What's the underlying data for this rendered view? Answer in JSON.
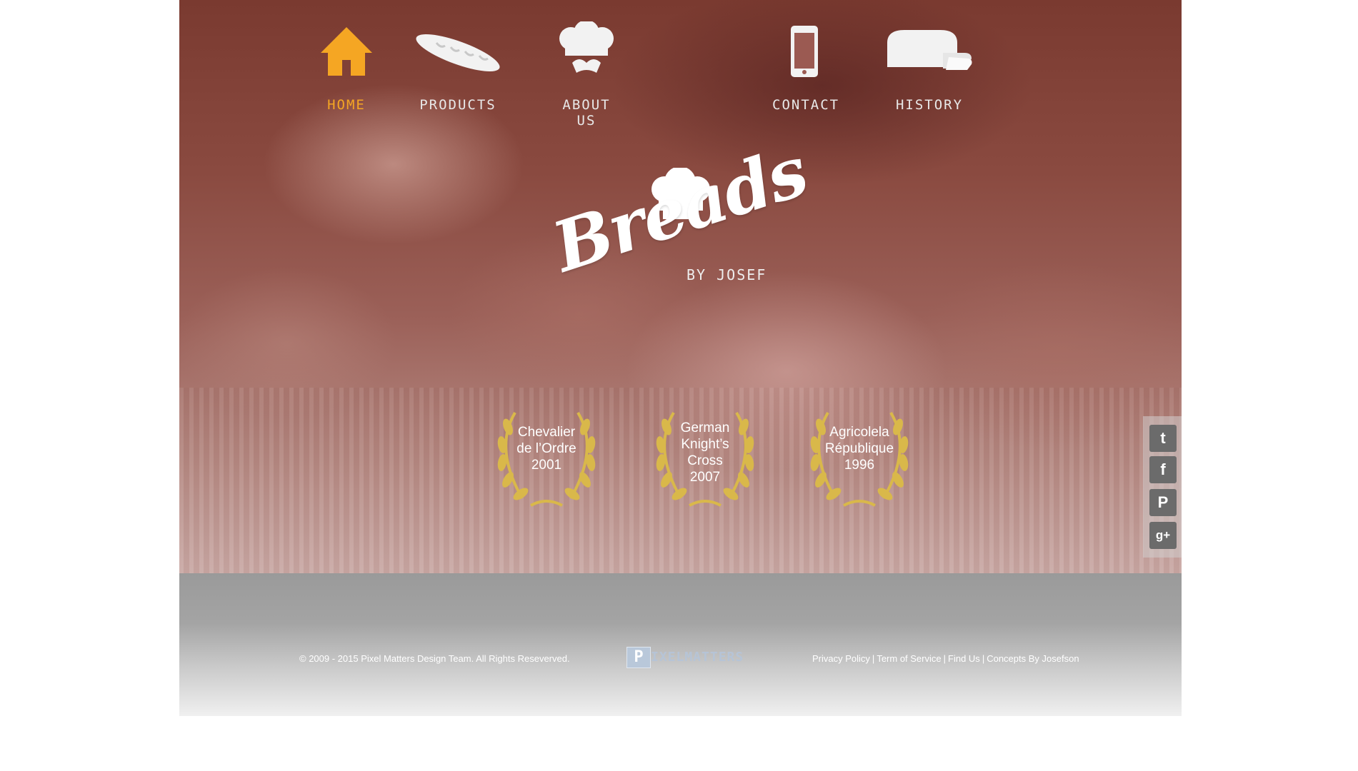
{
  "nav": {
    "items": [
      {
        "label": "HOME",
        "icon": "home-icon",
        "active": true
      },
      {
        "label": "PRODUCTS",
        "icon": "baguette-icon",
        "active": false
      },
      {
        "label": "ABOUT US",
        "icon": "chef-hat-icon",
        "active": false
      },
      {
        "label": "CONTACT",
        "icon": "smartphone-icon",
        "active": false
      },
      {
        "label": "HISTORY",
        "icon": "bread-loaf-icon",
        "active": false
      }
    ]
  },
  "logo": {
    "word": "Breads",
    "sub": "BY JOSEF",
    "icon": "chef-hat-icon"
  },
  "awards": [
    {
      "text": "Chevalier\nde l’Ordre\n2001",
      "icon": "laurel-wreath-icon"
    },
    {
      "text": "German\nKnight’s\nCross\n2007",
      "icon": "laurel-wreath-icon"
    },
    {
      "text": "Agricolela\nRépublique\n1996",
      "icon": "laurel-wreath-icon"
    }
  ],
  "social": [
    {
      "label": "t",
      "icon": "twitter-icon"
    },
    {
      "label": "f",
      "icon": "facebook-icon"
    },
    {
      "label": "P",
      "icon": "pinterest-icon"
    },
    {
      "label": "g+",
      "icon": "google-plus-icon"
    }
  ],
  "footer": {
    "copyright": "© 2009 - 2015 Pixel Matters Design Team. All Rights Reseverved.",
    "brand_initial": "P",
    "brand_rest": "IXELMATTERS",
    "links": [
      "Privacy Policy",
      "Term of Service",
      "Find Us",
      "Concepts By Josefson"
    ],
    "separator": "|"
  },
  "colors": {
    "accent": "#f5a623",
    "nav_text": "#e8e8e8",
    "award_gold": "#d9b84a",
    "social_bg": "#6b6b6b"
  }
}
